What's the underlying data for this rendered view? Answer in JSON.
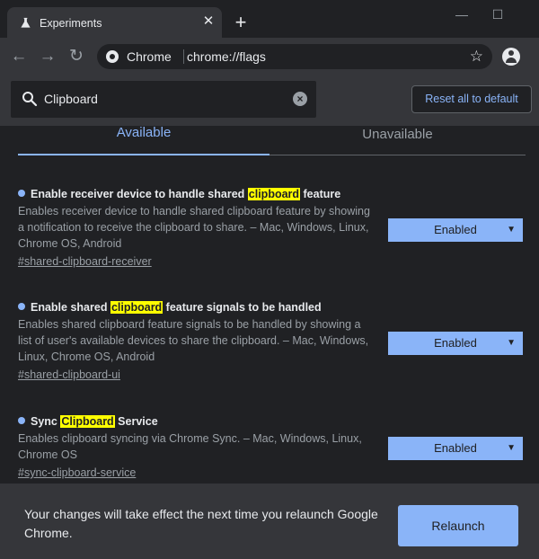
{
  "window": {
    "tab_title": "Experiments",
    "close_glyph": "✕",
    "new_tab_glyph": "+",
    "minimize_glyph": "—",
    "maximize_glyph": "☐"
  },
  "toolbar": {
    "back_glyph": "←",
    "forward_glyph": "→",
    "reload_glyph": "↻",
    "site_chip": "Chrome",
    "url": "chrome://flags",
    "star_glyph": "☆"
  },
  "search": {
    "value": "Clipboard",
    "clear_glyph": "×"
  },
  "reset_label": "Reset all to default",
  "tabs": {
    "available": "Available",
    "unavailable": "Unavailable"
  },
  "experiments": [
    {
      "title_before": "Enable receiver device to handle shared ",
      "title_highlight": "clipboard",
      "title_after": " feature",
      "description": "Enables receiver device to handle shared clipboard feature by showing a notification to receive the clipboard to share. – Mac, Windows, Linux, Chrome OS, Android",
      "link": "#shared-clipboard-receiver",
      "select_value": "Enabled"
    },
    {
      "title_before": "Enable shared ",
      "title_highlight": "clipboard",
      "title_after": " feature signals to be handled",
      "description": "Enables shared clipboard feature signals to be handled by showing a list of user's available devices to share the clipboard. – Mac, Windows, Linux, Chrome OS, Android",
      "link": "#shared-clipboard-ui",
      "select_value": "Enabled"
    },
    {
      "title_before": "Sync ",
      "title_highlight": "Clipboard",
      "title_after": " Service",
      "description": "Enables clipboard syncing via Chrome Sync. – Mac, Windows, Linux, Chrome OS",
      "link": "#sync-clipboard-service",
      "select_value": "Enabled"
    }
  ],
  "select_arrow": "▼",
  "footer": {
    "message": "Your changes will take effect the next time you relaunch Google Chrome.",
    "relaunch_label": "Relaunch"
  },
  "colors": {
    "accent": "#8ab4f8",
    "highlight": "#ffff00",
    "background": "#202124",
    "surface": "#35363a"
  }
}
